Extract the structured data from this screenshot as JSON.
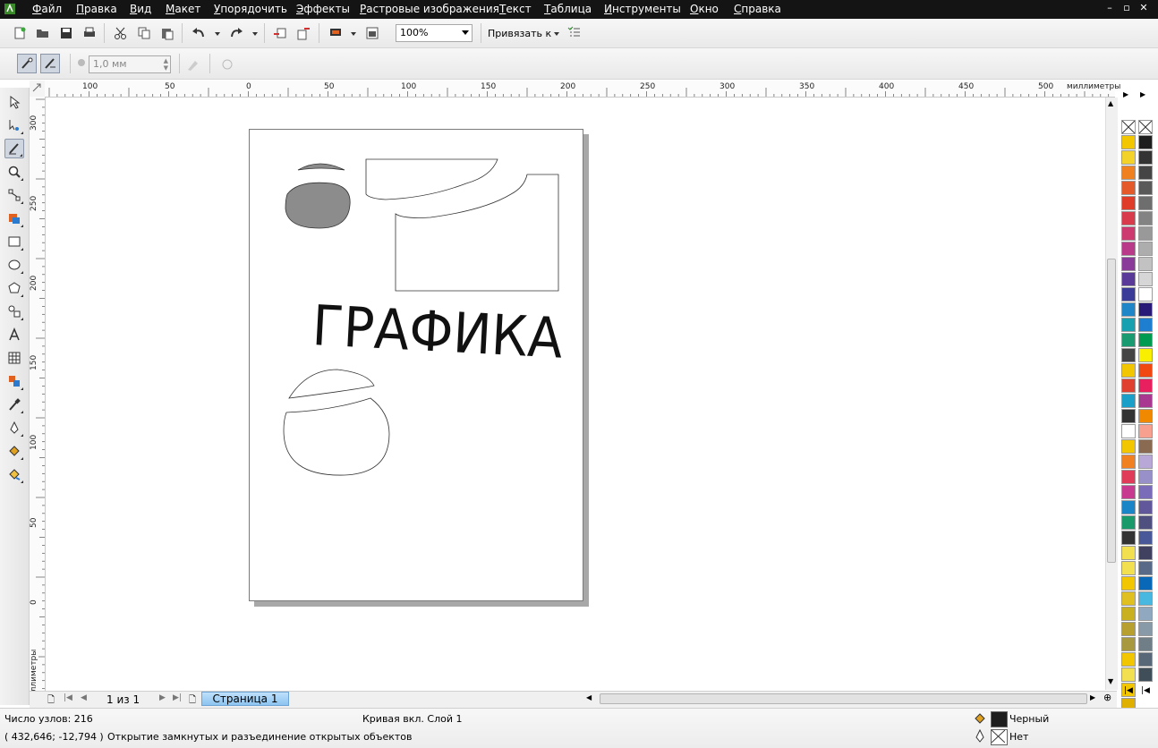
{
  "menu": {
    "items": [
      "Файл",
      "Правка",
      "Вид",
      "Макет",
      "Упорядочить",
      "Эффекты",
      "Растровые изображения",
      "Текст",
      "Таблица",
      "Инструменты",
      "Окно",
      "Справка"
    ]
  },
  "toolbar": {
    "zoom_value": "100%",
    "snap_label": "Привязать к",
    "outline_width": "1,0 мм"
  },
  "toolbox": {
    "tools": [
      "pick-tool",
      "shape-tool",
      "smear-tool",
      "zoom-tool",
      "freehand-tool",
      "smart-fill-tool",
      "rectangle-tool",
      "ellipse-tool",
      "polygon-tool",
      "basic-shapes-tool",
      "text-tool",
      "table-tool",
      "interactive-blend-tool",
      "eyedropper-tool",
      "outline-pen-tool",
      "fill-tool",
      "interactive-fill-tool"
    ],
    "active": "smear-tool"
  },
  "rulers": {
    "unit": "миллиметры",
    "top_labels": [
      "100",
      "50",
      "0",
      "50",
      "100",
      "150",
      "200",
      "250",
      "300",
      "350",
      "400",
      "450",
      "500"
    ],
    "left_labels": [
      "300",
      "250",
      "200",
      "150",
      "100",
      "50",
      "0"
    ],
    "left_unit": "миллиметры"
  },
  "canvas": {
    "text_art": "ГРАФИКА"
  },
  "page_nav": {
    "count": "1 из 1",
    "tab": "Страница 1"
  },
  "status": {
    "nodes": "Число узлов: 216",
    "object": "Кривая вкл. Слой 1",
    "coords": "( 432,646; -12,794 )",
    "hint": "Открытие замкнутых и разъединение открытых объектов",
    "fill_label": "Черный",
    "outline_label": "Нет"
  },
  "palette_left": [
    "none",
    "#f2c600",
    "#f3d32a",
    "#f08020",
    "#e45a2a",
    "#e03c2a",
    "#d83c4c",
    "#cc3a70",
    "#b83a88",
    "#8a3a98",
    "#5a3a98",
    "#3a3a98",
    "#1f86c8",
    "#16a0b0",
    "#1a9a70",
    "#444444",
    "#f2c600",
    "#e04030",
    "#1aa0c8",
    "#333333",
    "#ffffff",
    "#f2c600",
    "#f08020",
    "#e03c5a",
    "#c83a90",
    "#1a86c8",
    "#1a9a6a",
    "#333333",
    "#f2e050",
    "#f2e050",
    "#f2c600",
    "#e0c020",
    "#c8b020",
    "#b8a030",
    "#a89840",
    "#f2c600",
    "#f2e050",
    "#f2c600",
    "#e0b000"
  ],
  "palette_right": [
    "none",
    "#1e1e1e",
    "#333333",
    "#454545",
    "#595959",
    "#6e6e6e",
    "#838383",
    "#999999",
    "#adadad",
    "#c2c2c2",
    "#d6d6d6",
    "#ffffff",
    "#2a1a78",
    "#1e7fd0",
    "#009a50",
    "#f8f000",
    "#f04810",
    "#e82060",
    "#a83890",
    "#f08800",
    "#f8a090",
    "#8a6a50",
    "#b8a8d8",
    "#9890c8",
    "#7a6cb8",
    "#60589a",
    "#505080",
    "#485898",
    "#404060",
    "#586a88",
    "#0a68b8",
    "#48b8e0",
    "#90a8c0",
    "#889aa8",
    "#707e88",
    "#586878",
    "#404e5a"
  ],
  "accent": "#8cc4f0"
}
